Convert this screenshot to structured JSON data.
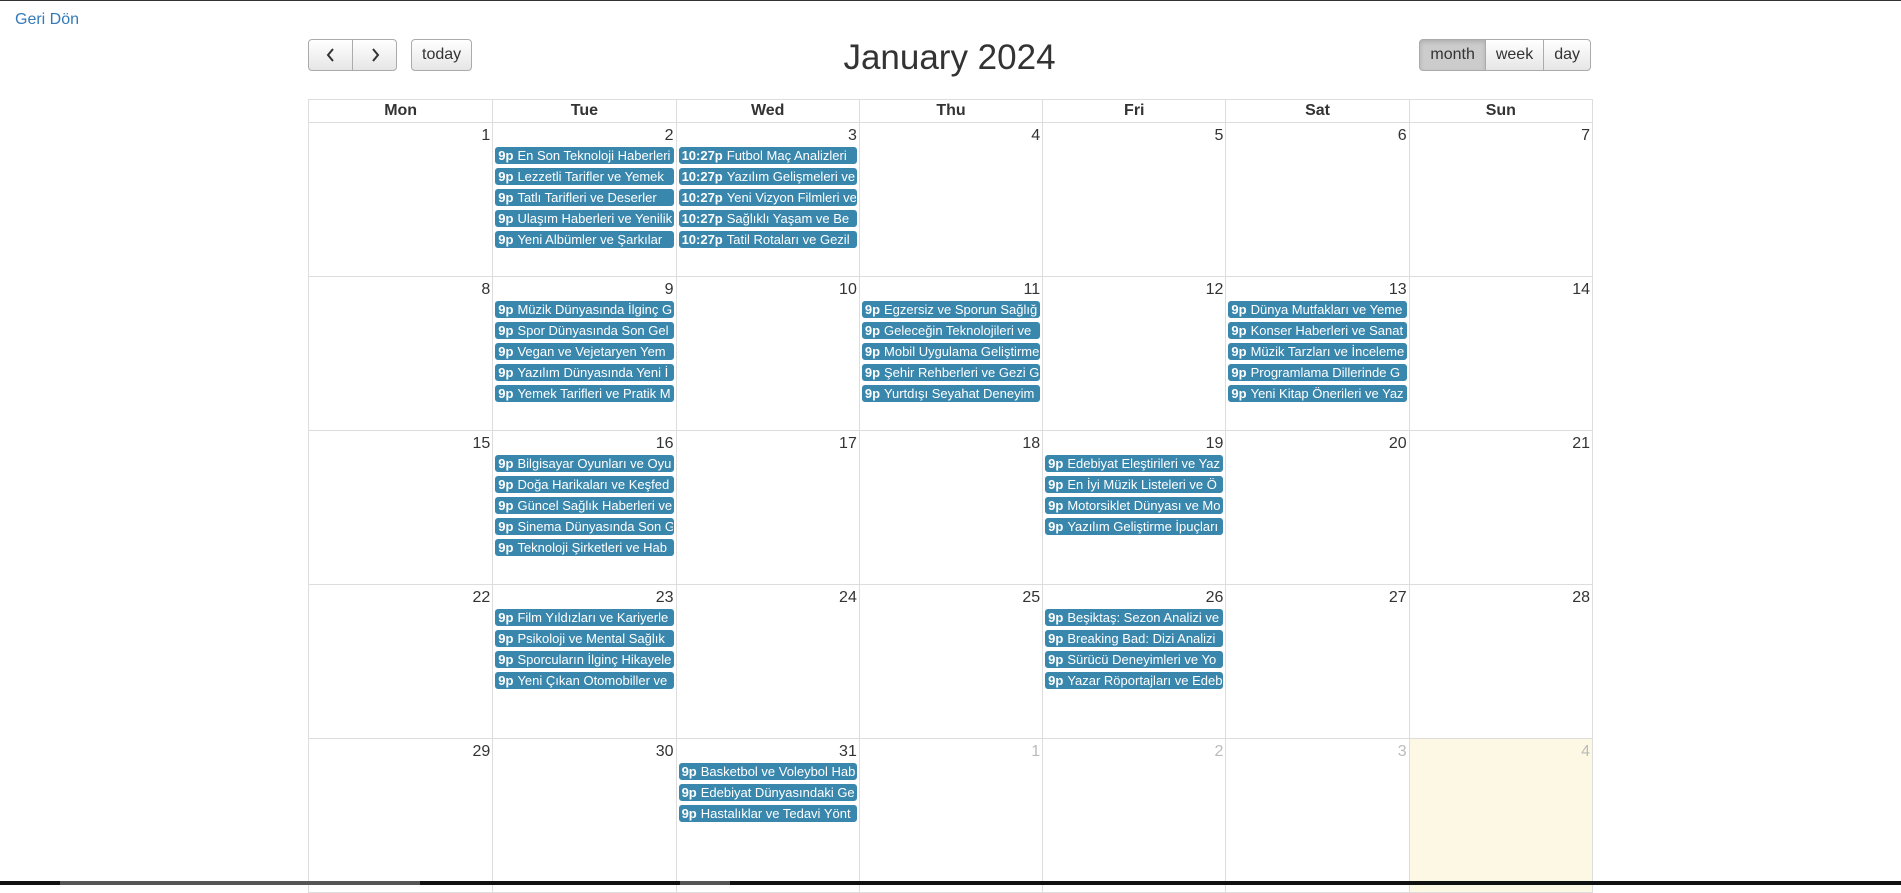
{
  "back_link": "Geri Dön",
  "toolbar": {
    "prev_icon": "chevron-left-icon",
    "next_icon": "chevron-right-icon",
    "today_label": "today",
    "title": "January 2024",
    "views": [
      "month",
      "week",
      "day"
    ],
    "active_view": "month"
  },
  "colors": {
    "event_bg": "#3a87ad",
    "today_bg": "#fcf8e3",
    "link": "#337ab7"
  },
  "day_headers": [
    "Mon",
    "Tue",
    "Wed",
    "Thu",
    "Fri",
    "Sat",
    "Sun"
  ],
  "weeks": [
    [
      {
        "day": "1",
        "other": false,
        "events": []
      },
      {
        "day": "2",
        "other": false,
        "events": [
          {
            "time": "9p",
            "title": "En Son Teknoloji Haberleri"
          },
          {
            "time": "9p",
            "title": "Lezzetli Tarifler ve Yemek"
          },
          {
            "time": "9p",
            "title": "Tatlı Tarifleri ve Deserler"
          },
          {
            "time": "9p",
            "title": "Ulaşım Haberleri ve Yenilik"
          },
          {
            "time": "9p",
            "title": "Yeni Albümler ve Şarkılar"
          }
        ]
      },
      {
        "day": "3",
        "other": false,
        "events": [
          {
            "time": "10:27p",
            "title": "Futbol Maç Analizleri"
          },
          {
            "time": "10:27p",
            "title": "Yazılım Gelişmeleri ve"
          },
          {
            "time": "10:27p",
            "title": "Yeni Vizyon Filmleri ve"
          },
          {
            "time": "10:27p",
            "title": "Sağlıklı Yaşam ve Be"
          },
          {
            "time": "10:27p",
            "title": "Tatil Rotaları ve Gezil"
          }
        ]
      },
      {
        "day": "4",
        "other": false,
        "events": []
      },
      {
        "day": "5",
        "other": false,
        "events": []
      },
      {
        "day": "6",
        "other": false,
        "events": []
      },
      {
        "day": "7",
        "other": false,
        "events": []
      }
    ],
    [
      {
        "day": "8",
        "other": false,
        "events": []
      },
      {
        "day": "9",
        "other": false,
        "events": [
          {
            "time": "9p",
            "title": "Müzik Dünyasında İlginç G"
          },
          {
            "time": "9p",
            "title": "Spor Dünyasında Son Gel"
          },
          {
            "time": "9p",
            "title": "Vegan ve Vejetaryen Yem"
          },
          {
            "time": "9p",
            "title": "Yazılım Dünyasında Yeni İ"
          },
          {
            "time": "9p",
            "title": "Yemek Tarifleri ve Pratik M"
          }
        ]
      },
      {
        "day": "10",
        "other": false,
        "events": []
      },
      {
        "day": "11",
        "other": false,
        "events": [
          {
            "time": "9p",
            "title": "Egzersiz ve Sporun Sağlığ"
          },
          {
            "time": "9p",
            "title": "Geleceğin Teknolojileri ve"
          },
          {
            "time": "9p",
            "title": "Mobil Uygulama Geliştirme"
          },
          {
            "time": "9p",
            "title": "Şehir Rehberleri ve Gezi G"
          },
          {
            "time": "9p",
            "title": "Yurtdışı Seyahat Deneyim"
          }
        ]
      },
      {
        "day": "12",
        "other": false,
        "events": []
      },
      {
        "day": "13",
        "other": false,
        "events": [
          {
            "time": "9p",
            "title": "Dünya Mutfakları ve Yeme"
          },
          {
            "time": "9p",
            "title": "Konser Haberleri ve Sanat"
          },
          {
            "time": "9p",
            "title": "Müzik Tarzları ve İnceleme"
          },
          {
            "time": "9p",
            "title": "Programlama Dillerinde G"
          },
          {
            "time": "9p",
            "title": "Yeni Kitap Önerileri ve Yaz"
          }
        ]
      },
      {
        "day": "14",
        "other": false,
        "events": []
      }
    ],
    [
      {
        "day": "15",
        "other": false,
        "events": []
      },
      {
        "day": "16",
        "other": false,
        "events": [
          {
            "time": "9p",
            "title": "Bilgisayar Oyunları ve Oyu"
          },
          {
            "time": "9p",
            "title": "Doğa Harikaları ve Keşfed"
          },
          {
            "time": "9p",
            "title": "Güncel Sağlık Haberleri ve"
          },
          {
            "time": "9p",
            "title": "Sinema Dünyasında Son G"
          },
          {
            "time": "9p",
            "title": "Teknoloji Şirketleri ve Hab"
          }
        ]
      },
      {
        "day": "17",
        "other": false,
        "events": []
      },
      {
        "day": "18",
        "other": false,
        "events": []
      },
      {
        "day": "19",
        "other": false,
        "events": [
          {
            "time": "9p",
            "title": "Edebiyat Eleştirileri ve Yaz"
          },
          {
            "time": "9p",
            "title": "En İyi Müzik Listeleri ve Ö"
          },
          {
            "time": "9p",
            "title": "Motorsiklet Dünyası ve Mo"
          },
          {
            "time": "9p",
            "title": "Yazılım Geliştirme İpuçları"
          }
        ]
      },
      {
        "day": "20",
        "other": false,
        "events": []
      },
      {
        "day": "21",
        "other": false,
        "events": []
      }
    ],
    [
      {
        "day": "22",
        "other": false,
        "events": []
      },
      {
        "day": "23",
        "other": false,
        "events": [
          {
            "time": "9p",
            "title": "Film Yıldızları ve Kariyerle"
          },
          {
            "time": "9p",
            "title": "Psikoloji ve Mental Sağlık"
          },
          {
            "time": "9p",
            "title": "Sporcuların İlginç Hikayele"
          },
          {
            "time": "9p",
            "title": "Yeni Çıkan Otomobiller ve"
          }
        ]
      },
      {
        "day": "24",
        "other": false,
        "events": []
      },
      {
        "day": "25",
        "other": false,
        "events": []
      },
      {
        "day": "26",
        "other": false,
        "events": [
          {
            "time": "9p",
            "title": "Beşiktaş: Sezon Analizi ve"
          },
          {
            "time": "9p",
            "title": "Breaking Bad: Dizi Analizi"
          },
          {
            "time": "9p",
            "title": "Sürücü Deneyimleri ve Yo"
          },
          {
            "time": "9p",
            "title": "Yazar Röportajları ve Edeb"
          }
        ]
      },
      {
        "day": "27",
        "other": false,
        "events": []
      },
      {
        "day": "28",
        "other": false,
        "events": []
      }
    ],
    [
      {
        "day": "29",
        "other": false,
        "events": []
      },
      {
        "day": "30",
        "other": false,
        "events": []
      },
      {
        "day": "31",
        "other": false,
        "events": [
          {
            "time": "9p",
            "title": "Basketbol ve Voleybol Hab"
          },
          {
            "time": "9p",
            "title": "Edebiyat Dünyasındaki Ge"
          },
          {
            "time": "9p",
            "title": "Hastalıklar ve Tedavi Yönt"
          }
        ]
      },
      {
        "day": "1",
        "other": true,
        "events": []
      },
      {
        "day": "2",
        "other": true,
        "events": []
      },
      {
        "day": "3",
        "other": true,
        "events": []
      },
      {
        "day": "4",
        "other": true,
        "today": true,
        "events": []
      }
    ]
  ]
}
